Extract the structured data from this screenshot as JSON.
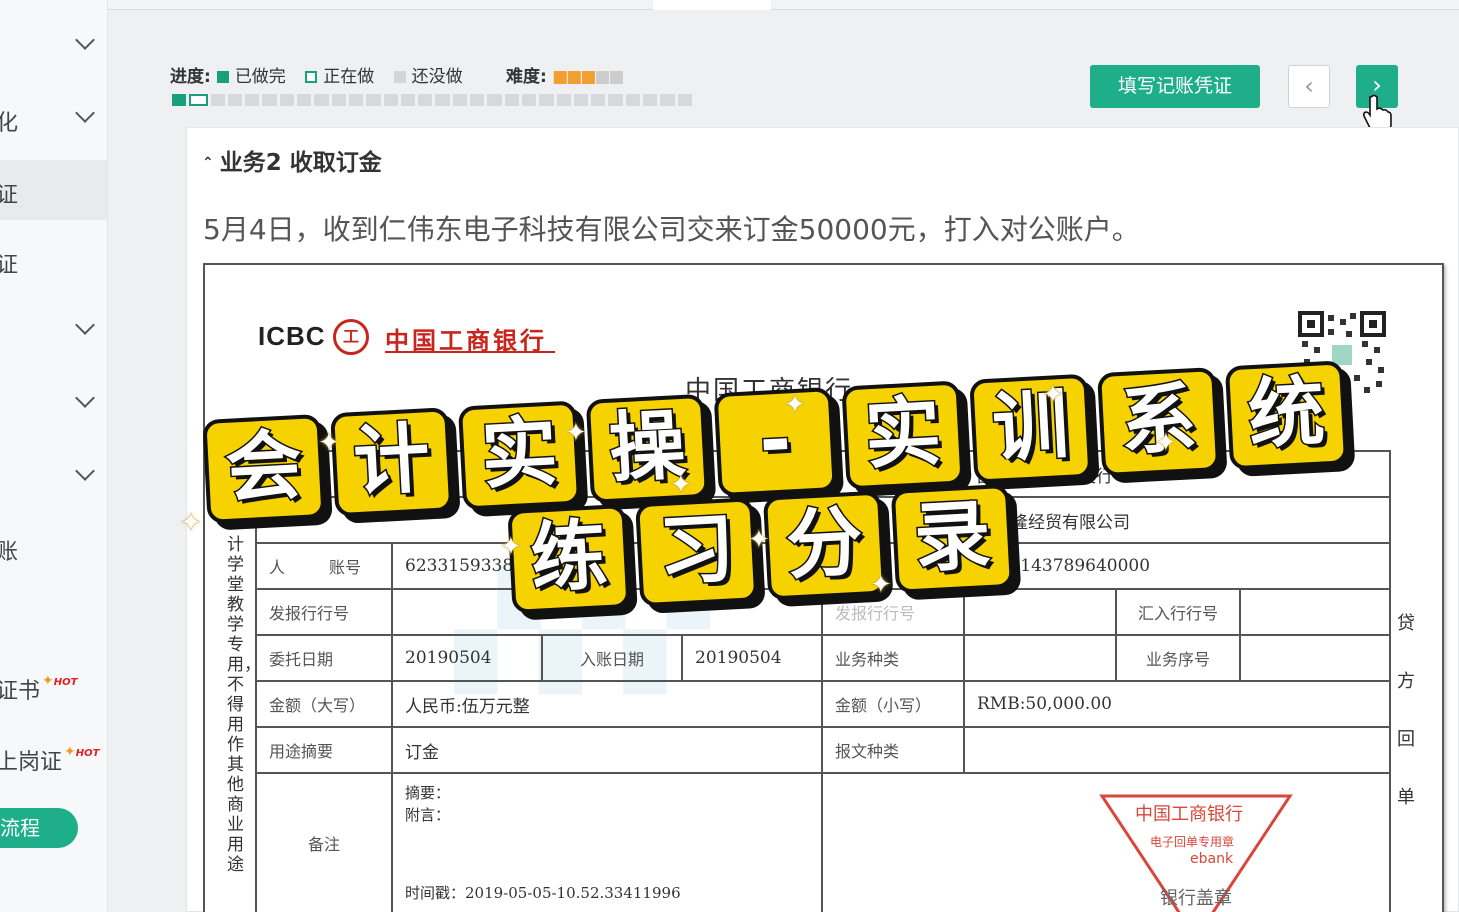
{
  "sidebar": {
    "items": [
      {
        "label": "",
        "has_chevron": true
      },
      {
        "label": "化",
        "has_chevron": true
      },
      {
        "label": "证",
        "has_chevron": false,
        "active": true
      },
      {
        "label": "证",
        "has_chevron": false
      },
      {
        "label": "",
        "has_chevron": true
      },
      {
        "label": "",
        "has_chevron": true
      },
      {
        "label": "",
        "has_chevron": true
      },
      {
        "label": "账",
        "has_chevron": false
      },
      {
        "label": "证书",
        "hot": "HOT"
      },
      {
        "label": "上岗证",
        "hot": "HOT"
      }
    ],
    "process_button": "流程"
  },
  "progress": {
    "label": "进度:",
    "legend_done": "已做完",
    "legend_doing": "正在做",
    "legend_todo": "还没做",
    "difficulty_label": "难度:",
    "difficulty_stars": 3,
    "difficulty_max": 5,
    "total_tasks": 30,
    "done_tasks": 1,
    "current_task": 2
  },
  "toolbar": {
    "voucher_button": "填写记账凭证",
    "prev_icon": "chevron-left-icon",
    "next_icon": "chevron-right-icon"
  },
  "business": {
    "title": "业务2 收取订金",
    "description": "5月4日，收到仁伟东电子科技有限公司交来订金50000元，打入对公账户。"
  },
  "receipt": {
    "bank_logo": "ICBC",
    "bank_seal": "工",
    "bank_name": "中国工商银行",
    "title": "中国工商银行",
    "side_text": "计学堂教学专用，不得用作其他商业用途",
    "right_text": "贷方回单",
    "payer_prefix": "人",
    "row_account_label": "账号",
    "payer_account": "62331593389",
    "payee_bank": "国银行湖南出支行",
    "payee_name": "市兴隆经贸有限公司",
    "payee_account": "0030143789640000",
    "row1": {
      "label1": "发报行行号",
      "value1": "",
      "label2": "发报行行号",
      "value2": "",
      "label3": "汇入行行号",
      "value3": ""
    },
    "row2": {
      "label1": "委托日期",
      "value1": "20190504",
      "label2": "入账日期",
      "value2": "20190504",
      "label3": "业务种类",
      "value3": "",
      "label4": "业务序号",
      "value4": ""
    },
    "row3": {
      "label1": "金额（大写）",
      "value1": "人民币:伍万元整",
      "label2": "金额（小写）",
      "value2": "RMB:50,000.00"
    },
    "row4": {
      "label1": "用途摘要",
      "value1": "订金",
      "label2": "报文种类",
      "value2": ""
    },
    "remark": {
      "label": "备注",
      "line1": "摘要：",
      "line2": "附言：",
      "time": "时间戳：2019-05-05-10.52.33411996"
    },
    "stamp": {
      "line1": "中国工商银行",
      "line2": "电子回单专用章",
      "line3": "ebank",
      "line4": "银行盖章"
    }
  },
  "banner": {
    "line1": [
      "会",
      "计",
      "实",
      "操",
      "-",
      "实",
      "训",
      "系",
      "统"
    ],
    "line2": [
      "练",
      "习",
      "分",
      "录"
    ]
  },
  "colors": {
    "accent": "#1fae8a",
    "banner_yellow": "#f6d200",
    "bank_red": "#c8261d"
  }
}
